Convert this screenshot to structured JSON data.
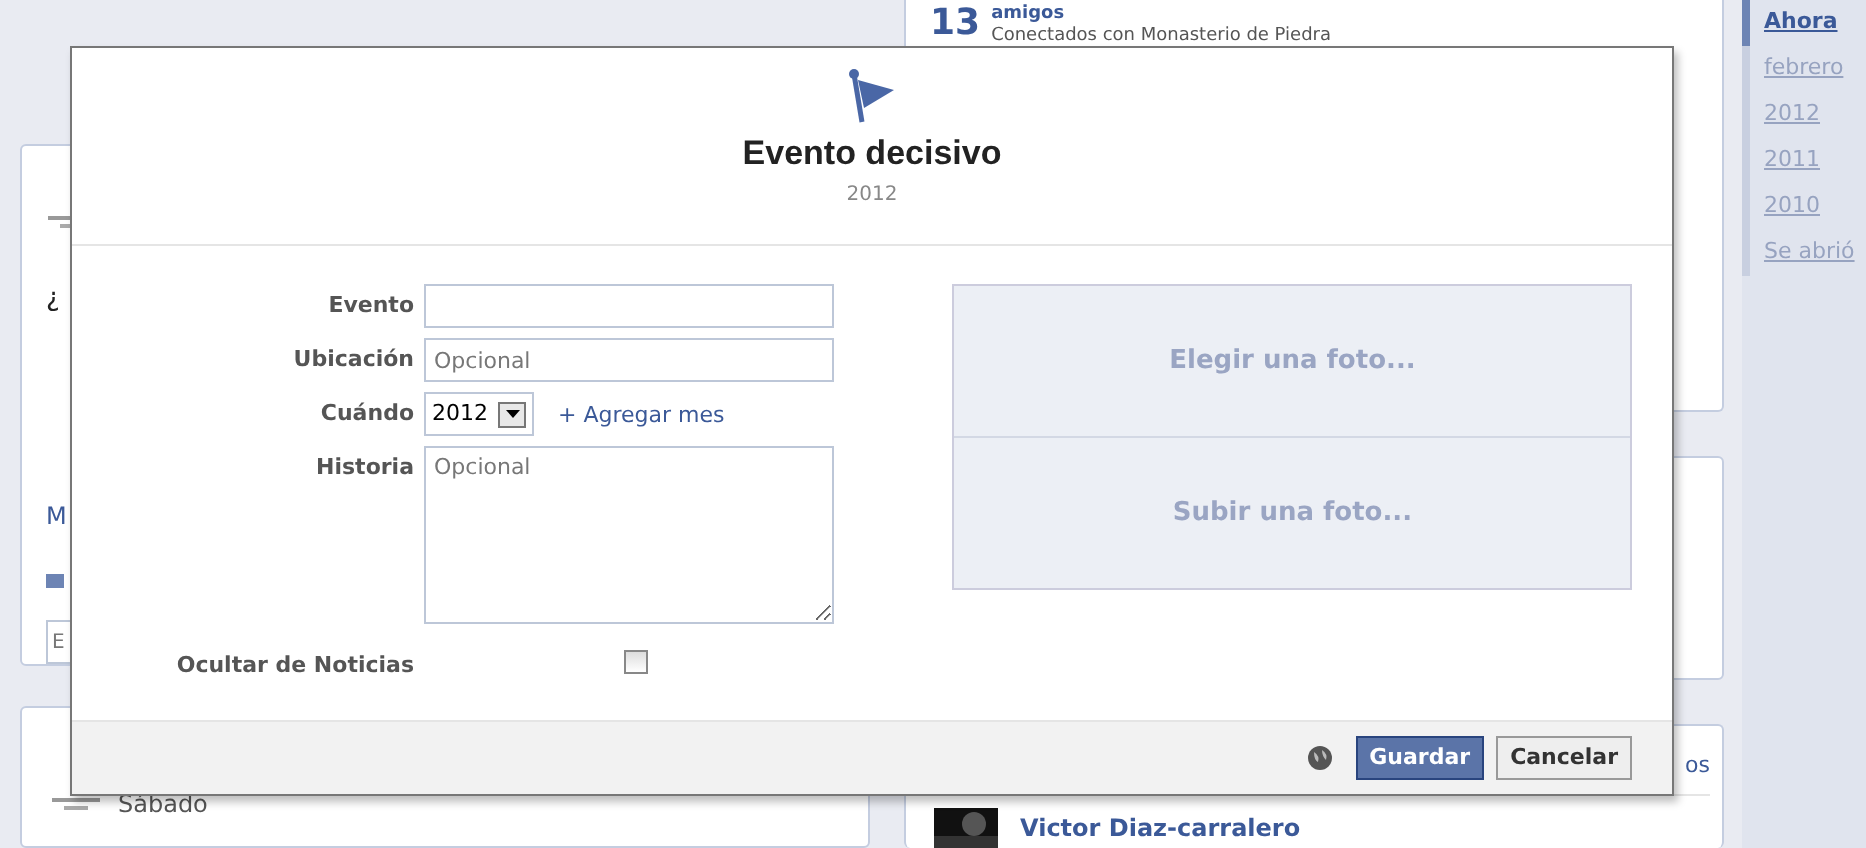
{
  "background": {
    "friends_count": "13",
    "friends_label": "amigos",
    "friends_subtitle": "Conectados con Monasterio de Piedra",
    "left_fragments": [
      "¿",
      "M",
      "E"
    ],
    "post_day": "Sábado",
    "person_name": "Victor Diaz-carralero",
    "link_fragment": "os"
  },
  "timeline": [
    {
      "label": "Ahora",
      "selected": true
    },
    {
      "label": "febrero",
      "selected": false
    },
    {
      "label": "2012",
      "selected": false
    },
    {
      "label": "2011",
      "selected": false
    },
    {
      "label": "2010",
      "selected": false
    },
    {
      "label": "Se abrió",
      "selected": false
    }
  ],
  "dialog": {
    "title": "Evento decisivo",
    "subtitle": "2012",
    "fields": [
      {
        "kind": "text",
        "label": "Evento"
      },
      {
        "kind": "text",
        "label": "Ubicación",
        "placeholder": "Opcional"
      },
      {
        "kind": "select",
        "label": "Cuándo",
        "value": "2012",
        "link_icon": "+",
        "link": "Agregar mes"
      },
      {
        "kind": "textarea",
        "label": "Historia",
        "placeholder": "Opcional"
      },
      {
        "kind": "checkbox",
        "label": "Ocultar de Noticias",
        "checked": false
      }
    ],
    "photo_options": [
      "Elegir una foto...",
      "Subir una foto..."
    ],
    "buttons": [
      {
        "label": "Guardar",
        "kind": "primary"
      },
      {
        "label": "Cancelar",
        "kind": "secondary"
      }
    ]
  }
}
